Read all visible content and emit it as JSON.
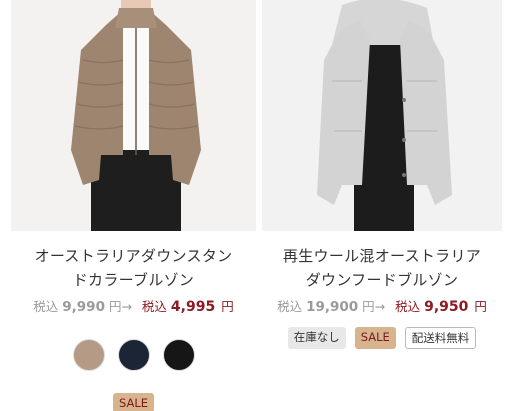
{
  "products": [
    {
      "title_line1": "オーストラリアダウンスタン",
      "title_line2": "ドカラーブルゾン",
      "tax_label": "税込",
      "orig_price": "9,990",
      "yen_arrow": "円→",
      "sale_tax_label": "税込",
      "sale_price": "4,995",
      "yen": "円",
      "swatches": [
        "#b59a85",
        "#1b2535",
        "#161616"
      ],
      "badges": [
        "SALE"
      ]
    },
    {
      "title_line1": "再生ウール混オーストラリア",
      "title_line2": "ダウンフードブルゾン",
      "tax_label": "税込",
      "orig_price": "19,900",
      "yen_arrow": "円→",
      "sale_tax_label": "税込",
      "sale_price": "9,950",
      "yen": "円",
      "badges": [
        "在庫なし",
        "SALE",
        "配送料無料"
      ]
    }
  ],
  "colors": {
    "sale_red": "#8c1a24",
    "sale_badge_bg": "#d7b48e",
    "gray_text": "#9a9a9a"
  }
}
